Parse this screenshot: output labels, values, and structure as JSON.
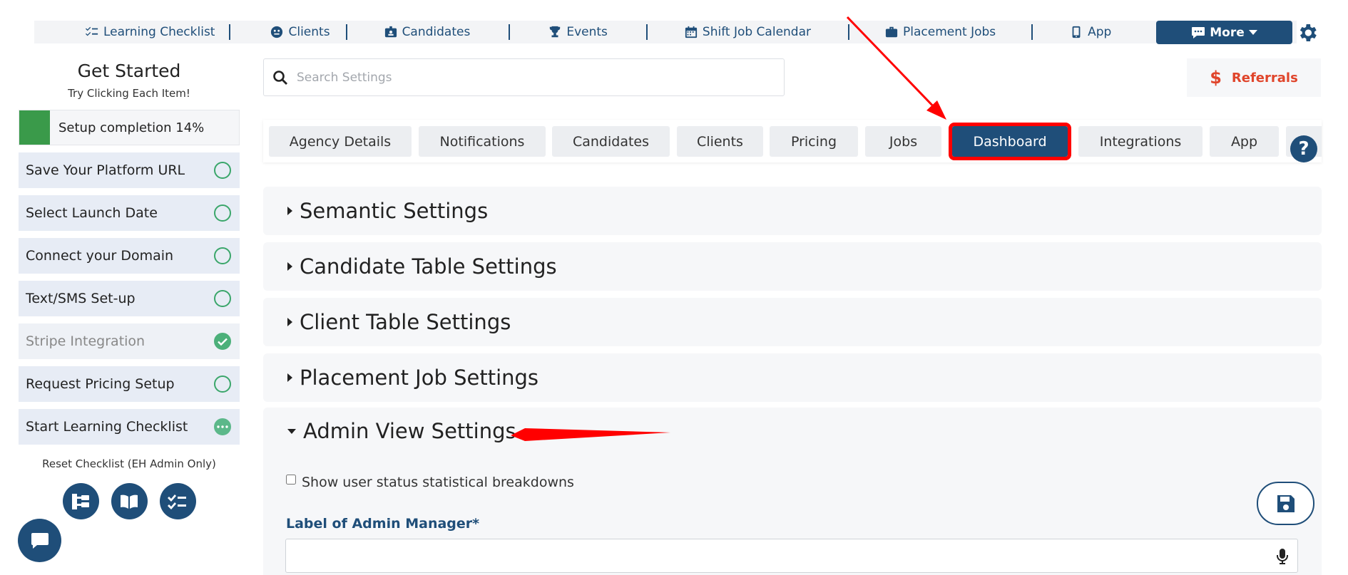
{
  "topnav": {
    "items": [
      {
        "label": "Learning Checklist",
        "icon": "checklist-icon"
      },
      {
        "label": "Clients",
        "icon": "client-icon"
      },
      {
        "label": "Candidates",
        "icon": "badge-icon"
      },
      {
        "label": "Events",
        "icon": "trophy-icon"
      },
      {
        "label": "Shift Job Calendar",
        "icon": "calendar-icon"
      },
      {
        "label": "Placement Jobs",
        "icon": "briefcase-icon"
      },
      {
        "label": "App",
        "icon": "phone-icon"
      }
    ],
    "more_label": "More",
    "accent": "#1f4e79"
  },
  "sidebar": {
    "title": "Get Started",
    "subtitle": "Try Clicking Each Item!",
    "progress_label": "Setup completion 14%",
    "progress_percent": 14,
    "items": [
      {
        "label": "Save Your Platform URL",
        "status": "pending"
      },
      {
        "label": "Select Launch Date",
        "status": "pending"
      },
      {
        "label": "Connect your Domain",
        "status": "pending"
      },
      {
        "label": "Text/SMS Set-up",
        "status": "pending"
      },
      {
        "label": "Stripe Integration",
        "status": "done"
      },
      {
        "label": "Request Pricing Setup",
        "status": "pending"
      },
      {
        "label": "Start Learning Checklist",
        "status": "in-progress"
      }
    ],
    "reset_label": "Reset Checklist (EH Admin Only)"
  },
  "search": {
    "placeholder": "Search Settings"
  },
  "referrals": {
    "label": "Referrals",
    "color": "#e0452b"
  },
  "tabs": [
    {
      "label": "Agency Details"
    },
    {
      "label": "Notifications"
    },
    {
      "label": "Candidates"
    },
    {
      "label": "Clients"
    },
    {
      "label": "Pricing"
    },
    {
      "label": "Jobs"
    },
    {
      "label": "Dashboard",
      "active": true
    },
    {
      "label": "Integrations"
    },
    {
      "label": "App"
    }
  ],
  "help_label": "?",
  "sections": [
    {
      "title": "Semantic Settings"
    },
    {
      "title": "Candidate Table Settings"
    },
    {
      "title": "Client Table Settings"
    },
    {
      "title": "Placement Job Settings"
    }
  ],
  "open_section": {
    "title": "Admin View Settings",
    "checkbox_label": "Show user status statistical breakdowns",
    "checkbox_checked": false,
    "field_label": "Label of Admin Manager*",
    "field_value": ""
  }
}
